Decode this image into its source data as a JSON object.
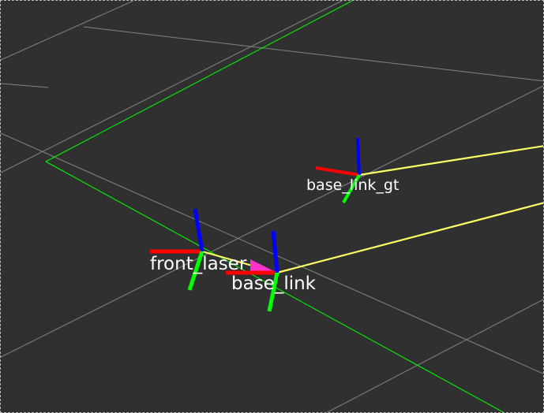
{
  "view": {
    "background": "#303030",
    "border_color": "#bdbdbd",
    "grid_color": "#a0a0a0",
    "map_outline_color": "#00ff00",
    "tf_link_color": "#ffff66",
    "axis_colors": {
      "x": "#ff0000",
      "y": "#00ff00",
      "z": "#0000ff"
    },
    "goal_marker_color": "#ff33cc"
  },
  "frames": [
    {
      "name": "front_laser"
    },
    {
      "name": "base_link"
    },
    {
      "name": "base_link_gt"
    }
  ]
}
